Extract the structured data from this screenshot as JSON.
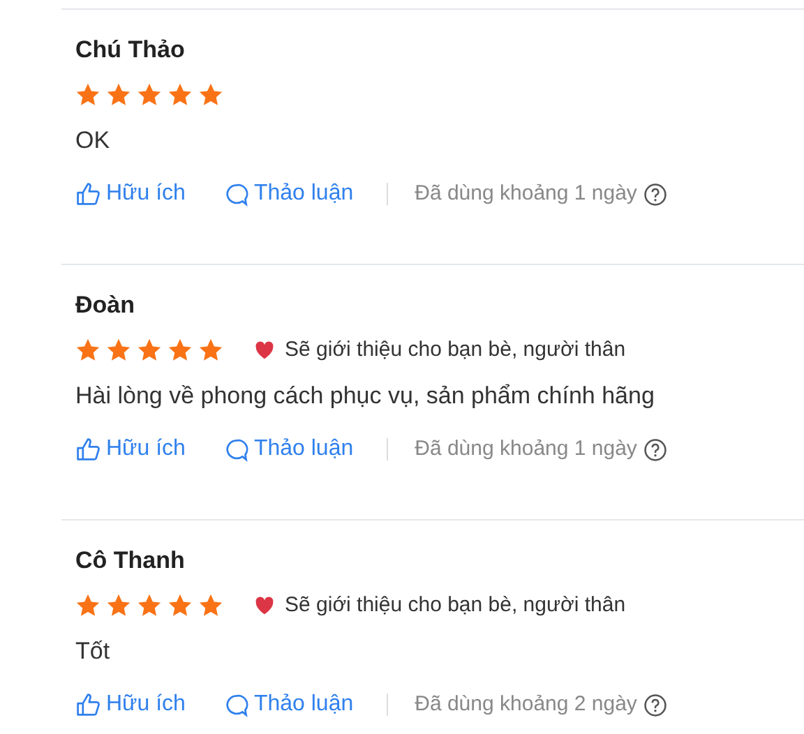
{
  "reviews": [
    {
      "name": "Chú Thảo",
      "stars": 5,
      "comment": "OK",
      "helpful": "Hữu ích",
      "discuss": "Thảo luận",
      "usage": "Đã dùng khoảng 1 ngày"
    },
    {
      "name": "Đoàn",
      "stars": 5,
      "recommend": "Sẽ giới thiệu cho bạn bè, người thân",
      "comment": "Hài lòng về phong cách phục vụ, sản phẩm chính hãng",
      "helpful": "Hữu ích",
      "discuss": "Thảo luận",
      "usage": "Đã dùng khoảng 1 ngày"
    },
    {
      "name": "Cô Thanh",
      "stars": 5,
      "recommend": "Sẽ giới thiệu cho bạn bè, người thân",
      "comment": "Tốt",
      "helpful": "Hữu ích",
      "discuss": "Thảo luận",
      "usage": "Đã dùng khoảng 2 ngày"
    }
  ]
}
